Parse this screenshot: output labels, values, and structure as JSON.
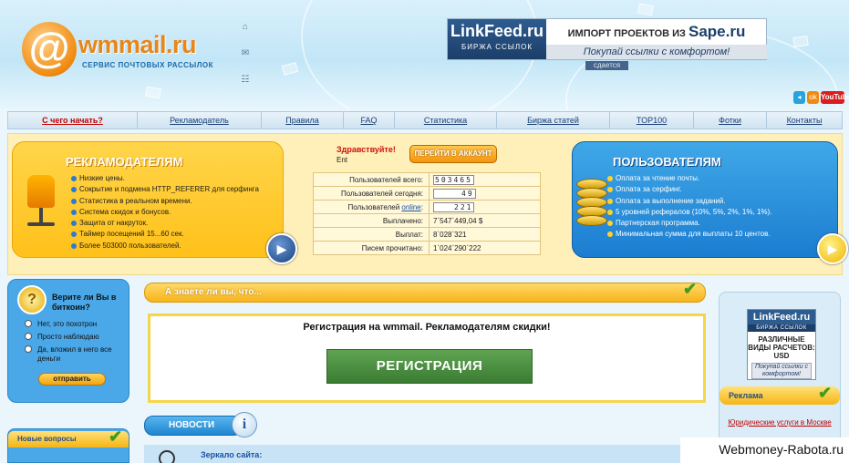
{
  "logo": {
    "name": "wmmail.ru",
    "at": "@",
    "subtitle": "СЕРВИС ПОЧТОВЫХ РАССЫЛОК"
  },
  "header_icons": [
    "home-icon",
    "mail-icon",
    "sitemap-icon"
  ],
  "top_banner": {
    "brand": "LinkFeed.ru",
    "brand_sub": "БИРЖА ССЫЛОК",
    "import_text": "ИМПОРТ ПРОЕКТОВ ИЗ",
    "import_brand": "Sape.ru",
    "slogan": "Покупай ссылки с комфортом!",
    "badge": "сдается"
  },
  "social": {
    "telegram": "◂",
    "ok": "ok",
    "youtube": "YouTube"
  },
  "nav": [
    {
      "label": "С чего начать?",
      "active": true
    },
    {
      "label": "Рекламодатель"
    },
    {
      "label": "Правила"
    },
    {
      "label": "FAQ"
    },
    {
      "label": "Статистика"
    },
    {
      "label": "Биржа статей"
    },
    {
      "label": "TOP100"
    },
    {
      "label": "Фотки"
    },
    {
      "label": "Контакты"
    }
  ],
  "advertisers": {
    "title": "РЕКЛАМОДАТЕЛЯМ",
    "items": [
      "Низкие цены.",
      "Сокрытие и подмена HTTP_REFERER для серфинга",
      "Статистика в реальном времени.",
      "Система скидок и бонусов.",
      "Защита от накруток.",
      "Таймер посещений 15...60 сек.",
      "Более 503000 пользователей."
    ]
  },
  "greeting": {
    "hello": "Здравствуйте!",
    "name": "Ent",
    "go_button": "ПЕРЕЙТИ В АККАУНТ"
  },
  "stats": {
    "users_total_label": "Пользователей всего:",
    "users_total": "503465",
    "users_today_label": "Пользователей сегодня:",
    "users_today": "49",
    "users_online_prefix": "Пользователей ",
    "users_online_link": "online",
    "users_online_suffix": ":",
    "users_online": "221",
    "paid_label": "Выплачено:",
    "paid": "7`547`449,04 $",
    "payouts_label": "Выплат:",
    "payouts": "8`028`321",
    "letters_label": "Писем прочитано:",
    "letters": "1`024`290`222"
  },
  "users": {
    "title": "ПОЛЬЗОВАТЕЛЯМ",
    "items": [
      "Оплата за чтение почты.",
      "Оплата за серфинг.",
      "Оплата за выполнение заданий.",
      "5 уровней рефералов (10%, 5%, 2%, 1%, 1%).",
      "Партнерская программа.",
      "Минимальная сумма для выплаты 10 центов."
    ]
  },
  "poll": {
    "question": "Верите ли Вы в биткоин?",
    "options": [
      "Нет, это похотрон",
      "Просто наблюдаю",
      "Да, вложил в него все деньги"
    ],
    "vote": "отправить"
  },
  "new_questions": {
    "title": "Новые вопросы"
  },
  "did_you_know": {
    "title": "А знаете ли вы, что..."
  },
  "registration": {
    "message": "Регистрация на wmmail. Рекламодателям скидки!",
    "button": "РЕГИСТРАЦИЯ"
  },
  "news": {
    "title": "НОВОСТИ",
    "info": "i"
  },
  "mirror": {
    "title": "Зеркало сайта:"
  },
  "right_ad": {
    "brand": "LinkFeed.ru",
    "brand_sub": "БИРЖА ССЫЛОК",
    "text": "РАЗЛИЧНЫЕ ВИДЫ РАСЧЕТОВ: USD",
    "slogan": "Покупай ссылки с комфортом!"
  },
  "reklama": {
    "title": "Реклама",
    "link": "Юридические услуги в Москве"
  },
  "watermark": "Webmoney-Rabota.ru",
  "colors": {
    "accent_orange": "#f5b514",
    "accent_blue": "#1f85d1",
    "link_red": "#c00000",
    "reg_green": "#3b7d33"
  }
}
